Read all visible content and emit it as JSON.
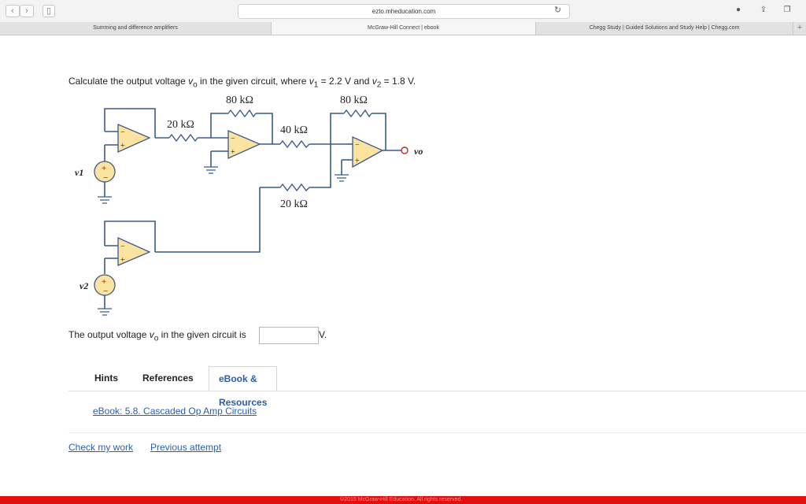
{
  "browser": {
    "url": "ezto.mheducation.com",
    "tabs": [
      "Summing and difference amplifiers",
      "McGraw-Hill Connect | ebook",
      "Chegg Study | Guided Solutions and Study Help | Chegg.com"
    ]
  },
  "question": {
    "prefix": "Calculate the output voltage ",
    "vo_sym": "v",
    "vo_sub": "o",
    "middle": " in the given circuit, where ",
    "v1_sym": "v",
    "v1_sub": "1",
    "v1_val": " = 2.2 V and ",
    "v2_sym": "v",
    "v2_sub": "2",
    "v2_val": " = 1.8 V."
  },
  "circuit": {
    "r_fb1": "80 kΩ",
    "r_fb2": "80 kΩ",
    "r_in1": "20 kΩ",
    "r_in2": "40 kΩ",
    "r_in3": "20 kΩ",
    "source1_label": "v1",
    "source2_label": "v2",
    "output_label": "vo"
  },
  "answer": {
    "prefix": "The output voltage ",
    "vo_sym": "v",
    "vo_sub": "o",
    "suffix": " in the given circuit is",
    "unit": "V.",
    "value": ""
  },
  "resource_tabs": [
    "Hints",
    "References",
    "eBook & Resources"
  ],
  "ebook_link": "eBook: 5.8. Cascaded Op Amp Circuits",
  "links": {
    "check": "Check my work",
    "previous": "Previous attempt"
  },
  "footer": "©2015 McGraw-Hill Education. All rights reserved."
}
